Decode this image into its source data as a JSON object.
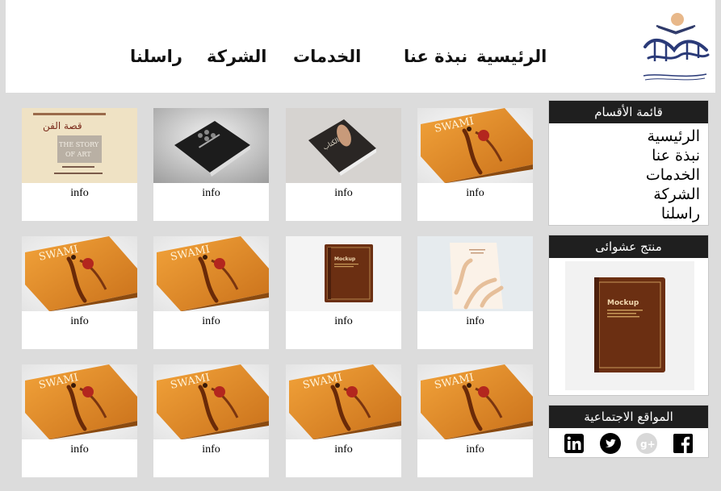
{
  "header": {
    "nav": [
      {
        "label": "الرئيسية"
      },
      {
        "label": "نبذة عنا"
      },
      {
        "label": "الخدمات"
      },
      {
        "label": "الشركة"
      },
      {
        "label": "راسلنا"
      }
    ],
    "logo": {
      "icon": "publisher-logo-icon"
    }
  },
  "sidebar": {
    "categories": {
      "title": "قائمة الأقسام",
      "items": [
        {
          "label": "الرئيسية"
        },
        {
          "label": "نبذة عنا"
        },
        {
          "label": "الخدمات"
        },
        {
          "label": "الشركة"
        },
        {
          "label": "راسلنا"
        }
      ]
    },
    "random_product": {
      "title": "منتج عشوائى",
      "image": "mockup-brown-book-image"
    },
    "social": {
      "title": "المواقع الاجتماعية",
      "icons": [
        "linkedin-icon",
        "twitter-icon",
        "google-plus-icon",
        "facebook-icon"
      ]
    }
  },
  "products": [
    {
      "label": "info",
      "image": "swami-orange-book"
    },
    {
      "label": "info",
      "image": "dark-book-hand"
    },
    {
      "label": "info",
      "image": "black-book-mockup"
    },
    {
      "label": "info",
      "image": "beige-arabic-book"
    },
    {
      "label": "info",
      "image": "floral-cream-book"
    },
    {
      "label": "info",
      "image": "brown-mockup-book"
    },
    {
      "label": "info",
      "image": "swami-orange-book"
    },
    {
      "label": "info",
      "image": "swami-orange-book"
    },
    {
      "label": "info",
      "image": "swami-orange-book"
    },
    {
      "label": "info",
      "image": "swami-orange-book"
    },
    {
      "label": "info",
      "image": "swami-orange-book"
    },
    {
      "label": "info",
      "image": "swami-orange-book"
    }
  ],
  "colors": {
    "background": "#dcdcdc",
    "panel_title_bg": "#1f1f1f",
    "book_orange": "#e8912a",
    "mockup_brown": "#7a3a1a"
  }
}
